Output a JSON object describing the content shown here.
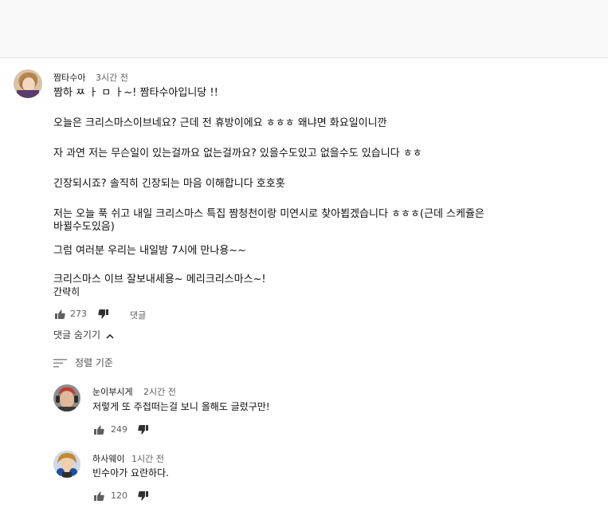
{
  "comment": {
    "author": "짬타수아",
    "time": "3시간 전",
    "lines": [
      "짬하 ㅉ ㅏ ㅁ ㅏ~! 짬타수아입니당 !!",
      "오늘은 크리스마스이브네요? 근데 전 휴방이에요 ㅎㅎㅎ 왜냐면 화요일이니깐",
      "자 과연 저는 무슨일이 있는걸까요 없는걸까요? 있을수도있고 없을수도 있습니다 ㅎㅎ",
      "긴장되시죠? 솔직히 긴장되는 마음 이해합니다 호호홋",
      "저는 오늘 푹 쉬고 내일 크리스마스 특집 짬청천이랑 미연시로 찾아뵙겠습니다 ㅎㅎㅎ(근데 스케쥴은",
      "바뀔수도있음)",
      "그럼 여러분 우리는 내일밤 7시에 만나용~~",
      "크리스마스 이브 잘보내세용~ 메리크리스마스~!"
    ],
    "show_less": "간략히",
    "likes": "273",
    "reply_label": "댓글",
    "hide_replies": "댓글 숨기기"
  },
  "sort": {
    "label": "정렬 기준"
  },
  "replies": [
    {
      "author": "눈이부시게",
      "time": "2시간 전",
      "text": "저렇게 또 주접떠는걸 보니 올해도 글렀구만!",
      "likes": "249"
    },
    {
      "author": "하사웨이",
      "time": "1시간 전",
      "text": "빈수아가 요란하다.",
      "likes": "120"
    }
  ]
}
